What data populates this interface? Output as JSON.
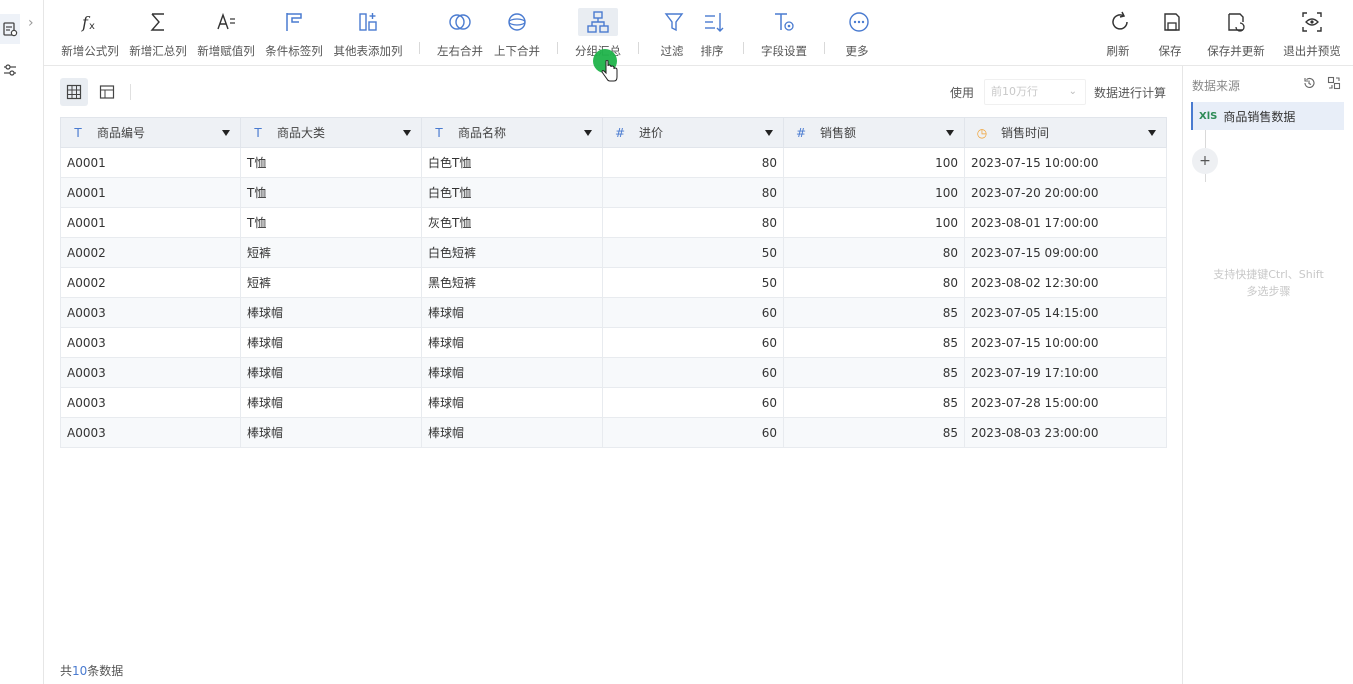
{
  "toolbar": {
    "items": [
      {
        "label": "新增公式列",
        "icon": "formula-icon"
      },
      {
        "label": "新增汇总列",
        "icon": "sigma-icon"
      },
      {
        "label": "新增赋值列",
        "icon": "assign-icon"
      },
      {
        "label": "条件标签列",
        "icon": "flag-icon"
      },
      {
        "label": "其他表添加列",
        "icon": "add-column-icon"
      },
      {
        "label": "左右合并",
        "icon": "merge-horizontal-icon"
      },
      {
        "label": "上下合并",
        "icon": "merge-vertical-icon"
      },
      {
        "label": "分组汇总",
        "icon": "group-summary-icon"
      },
      {
        "label": "过滤",
        "icon": "filter-icon"
      },
      {
        "label": "排序",
        "icon": "sort-icon"
      },
      {
        "label": "字段设置",
        "icon": "field-settings-icon"
      },
      {
        "label": "更多",
        "icon": "more-icon"
      }
    ],
    "right_items": [
      {
        "label": "刷新",
        "icon": "refresh-icon"
      },
      {
        "label": "保存",
        "icon": "save-icon"
      },
      {
        "label": "保存并更新",
        "icon": "save-update-icon"
      },
      {
        "label": "退出并预览",
        "icon": "preview-icon"
      }
    ]
  },
  "controls": {
    "use_label": "使用",
    "use_select": "前10万行",
    "use_suffix": "数据进行计算"
  },
  "table": {
    "columns": [
      {
        "name": "商品编号",
        "type": "T"
      },
      {
        "name": "商品大类",
        "type": "T"
      },
      {
        "name": "商品名称",
        "type": "T"
      },
      {
        "name": "进价",
        "type": "#"
      },
      {
        "name": "销售额",
        "type": "#"
      },
      {
        "name": "销售时间",
        "type": "time"
      }
    ],
    "rows": [
      [
        "A0001",
        "T恤",
        "白色T恤",
        "80",
        "100",
        "2023-07-15 10:00:00"
      ],
      [
        "A0001",
        "T恤",
        "白色T恤",
        "80",
        "100",
        "2023-07-20 20:00:00"
      ],
      [
        "A0001",
        "T恤",
        "灰色T恤",
        "80",
        "100",
        "2023-08-01 17:00:00"
      ],
      [
        "A0002",
        "短裤",
        "白色短裤",
        "50",
        "80",
        "2023-07-15 09:00:00"
      ],
      [
        "A0002",
        "短裤",
        "黑色短裤",
        "50",
        "80",
        "2023-08-02 12:30:00"
      ],
      [
        "A0003",
        "棒球帽",
        "棒球帽",
        "60",
        "85",
        "2023-07-05 14:15:00"
      ],
      [
        "A0003",
        "棒球帽",
        "棒球帽",
        "60",
        "85",
        "2023-07-15 10:00:00"
      ],
      [
        "A0003",
        "棒球帽",
        "棒球帽",
        "60",
        "85",
        "2023-07-19 17:10:00"
      ],
      [
        "A0003",
        "棒球帽",
        "棒球帽",
        "60",
        "85",
        "2023-07-28 15:00:00"
      ],
      [
        "A0003",
        "棒球帽",
        "棒球帽",
        "60",
        "85",
        "2023-08-03 23:00:00"
      ]
    ]
  },
  "footer": {
    "prefix": "共",
    "count": "10",
    "suffix": "条数据"
  },
  "right_panel": {
    "title": "数据来源",
    "source_badge": "XlS",
    "source_name": "商品销售数据",
    "add_label": "+",
    "hint_line1": "支持快捷键Ctrl、Shift",
    "hint_line2": "多选步骤"
  },
  "colors": {
    "accent": "#4a7bd0",
    "cursor": "#1fb34a",
    "header_bg": "#eef1f5"
  }
}
